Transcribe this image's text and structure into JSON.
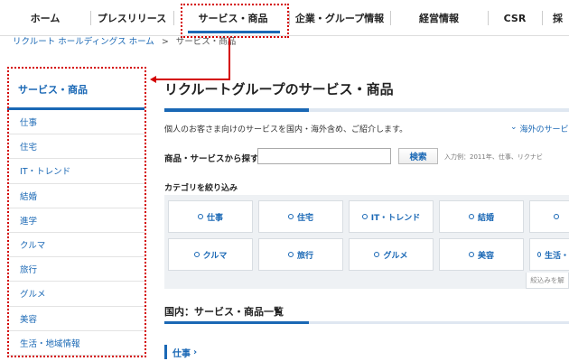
{
  "nav": {
    "items": [
      {
        "label": "ホーム"
      },
      {
        "label": "プレスリリース"
      },
      {
        "label": "サービス・商品"
      },
      {
        "label": "企業・グループ情報"
      },
      {
        "label": "経営情報"
      },
      {
        "label": "CSR"
      },
      {
        "label": "採"
      }
    ],
    "active_index": 2
  },
  "breadcrumb": {
    "home": "リクルート ホールディングス ホーム",
    "separator": ">",
    "current": "サービス・商品"
  },
  "sidebar": {
    "title": "サービス・商品",
    "items": [
      {
        "label": "仕事"
      },
      {
        "label": "住宅"
      },
      {
        "label": "IT・トレンド"
      },
      {
        "label": "結婚"
      },
      {
        "label": "進学"
      },
      {
        "label": "クルマ"
      },
      {
        "label": "旅行"
      },
      {
        "label": "グルメ"
      },
      {
        "label": "美容"
      },
      {
        "label": "生活・地域情報"
      }
    ]
  },
  "main": {
    "title": "リクルートグループのサービス・商品",
    "intro": "個人のお客さま向けのサービスを国内・海外含め、ご紹介します。",
    "overseas_link": "海外のサービス",
    "search": {
      "label": "商品・サービスから探す",
      "placeholder": "",
      "button": "検索",
      "example": "入力例：2011年、仕事、リクナビ"
    },
    "filter_label": "カテゴリを絞り込み",
    "categories": [
      {
        "label": "仕事"
      },
      {
        "label": "住宅"
      },
      {
        "label": "IT・トレンド"
      },
      {
        "label": "結婚"
      },
      {
        "label": ""
      },
      {
        "label": "クルマ"
      },
      {
        "label": "旅行"
      },
      {
        "label": "グルメ"
      },
      {
        "label": "美容"
      },
      {
        "label": "生活・"
      }
    ],
    "narrow_tab": "絞込みを解",
    "section_title": "国内：サービス・商品一覧",
    "subsection": "仕事",
    "chevron_icon": "chevron-right-icon"
  },
  "colors": {
    "accent": "#1a68b5",
    "highlight": "#d40000"
  }
}
